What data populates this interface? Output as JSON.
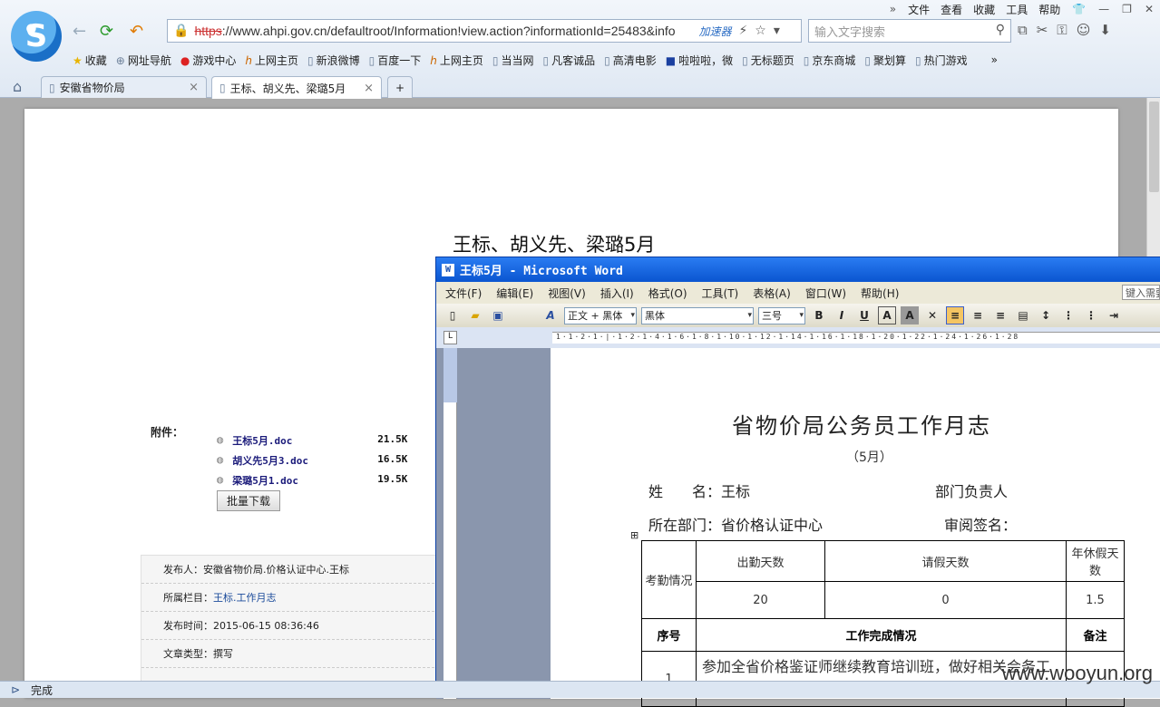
{
  "browser": {
    "menu": [
      "文件",
      "查看",
      "收藏",
      "工具",
      "帮助"
    ],
    "address": {
      "strike": "https",
      "rest": "://www.ahpi.gov.cn/defaultroot/Information!view.action?informationId=25483&info",
      "accelerator": "加速器"
    },
    "search_placeholder": "输入文字搜索",
    "favorites": [
      "收藏",
      "网址导航",
      "游戏中心",
      "上网主页",
      "新浪微博",
      "百度一下",
      "上网主页",
      "当当网",
      "凡客诚品",
      "高清电影",
      "啦啦啦，微",
      "无标题页",
      "京东商城",
      "聚划算",
      "热门游戏"
    ],
    "tabs": [
      {
        "label": "安徽省物价局"
      },
      {
        "label": "王标、胡义先、梁璐5月"
      }
    ],
    "status": "完成"
  },
  "page": {
    "title": "王标、胡义先、梁璐5月",
    "attachments_label": "附件：",
    "attachments": [
      {
        "name": "王标5月.doc",
        "size": "21.5K"
      },
      {
        "name": "胡义先5月3.doc",
        "size": "16.5K"
      },
      {
        "name": "梁璐5月1.doc",
        "size": "19.5K"
      }
    ],
    "batch_download": "批量下载",
    "meta": {
      "publisher": "发布人：安徽省物价局.价格认证中心.王标",
      "column_label": "所属栏目：",
      "column_link": "王标.工作月志",
      "time": "发布时间：2015-06-15 08:36:46",
      "type": "文章类型：撰写"
    }
  },
  "word": {
    "title": "王标5月 - Microsoft Word",
    "menu": [
      "文件(F)",
      "编辑(E)",
      "视图(V)",
      "插入(I)",
      "格式(O)",
      "工具(T)",
      "表格(A)",
      "窗口(W)",
      "帮助(H)"
    ],
    "help_box": "键入需要",
    "style": "正文 + 黑体",
    "font": "黑体",
    "size": "三号",
    "doc": {
      "title": "省物价局公务员工作月志",
      "subtitle": "（5月）",
      "name_line": "姓　　名：王标",
      "dept_head": "部门负责人",
      "dept_line": "所在部门：省价格认证中心",
      "review": "审阅签名：",
      "table": {
        "attendance": "考勤情况",
        "work_days": "出勤天数",
        "leave_days": "请假天数",
        "annual": "年休假天数",
        "work_days_val": "20",
        "leave_days_val": "0",
        "annual_val": "1.5",
        "seq": "序号",
        "progress": "工作完成情况",
        "remark": "备注",
        "row1_no": "1",
        "row1_text": "参加全省价格鉴证师继续教育培训班，做好相关会务工作。"
      }
    }
  },
  "watermark": "www.wooyun.org"
}
